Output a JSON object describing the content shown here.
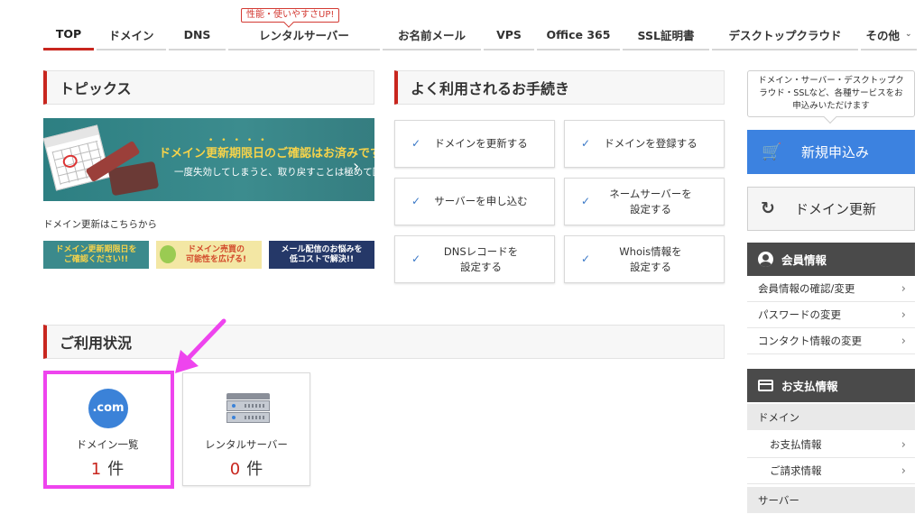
{
  "nav": {
    "items": [
      "TOP",
      "ドメイン",
      "DNS",
      "レンタルサーバー",
      "お名前メール",
      "VPS",
      "Office 365",
      "SSL証明書",
      "デスクトップクラウド",
      "その他"
    ],
    "more_chevron_icon": "chevron-down-icon",
    "promo_badge": "性能・使いやすさUP!"
  },
  "topics": {
    "header": "トピックス",
    "banner_title": "ドメイン更新期限日のご確認はお済みですか?",
    "banner_sub": "一度失効してしまうと、取り戻すことは極めて困難です。",
    "banner_dots": "•••••",
    "banner_arrow": "›",
    "renew_link_text": "ドメイン更新はこちらから",
    "mini_banners": [
      "ドメイン更新期限日を\nご確認ください!!",
      "ドメイン売買の\n可能性を広げる!",
      "メール配信のお悩みを\n低コストで解決!!"
    ]
  },
  "procedures": {
    "header": "よく利用されるお手続き",
    "check_icon": "check-icon",
    "items": [
      "ドメインを更新する",
      "ドメインを登録する",
      "サーバーを申し込む",
      "ネームサーバーを\n設定する",
      "DNSレコードを\n設定する",
      "Whois情報を\n設定する"
    ]
  },
  "usage": {
    "header": "ご利用状況",
    "cards": [
      {
        "icon_text": ".com",
        "label": "ドメイン一覧",
        "count": "1",
        "unit": "件"
      },
      {
        "icon": "server-icon",
        "label": "レンタルサーバー",
        "count": "0",
        "unit": "件"
      }
    ]
  },
  "sidebar": {
    "bubble": "ドメイン・サーバー・デスクトップクラウド・SSLなど、各種サービスをお申込みいただけます",
    "new_button": "新規申込み",
    "new_icon": "cart-icon",
    "renew_button": "ドメイン更新",
    "renew_icon": "refresh-icon",
    "member": {
      "title": "会員情報",
      "items": [
        "会員情報の確認/変更",
        "パスワードの変更",
        "コンタクト情報の変更"
      ]
    },
    "payment": {
      "title": "お支払情報",
      "groups": [
        {
          "name": "ドメイン",
          "items": [
            "お支払情報",
            "ご請求情報"
          ]
        },
        {
          "name": "サーバー",
          "items": []
        }
      ]
    },
    "chevron": "›"
  },
  "colors": {
    "accent_red": "#c8261e",
    "primary_blue": "#3c82e0",
    "highlight_magenta": "#ee44ee"
  }
}
